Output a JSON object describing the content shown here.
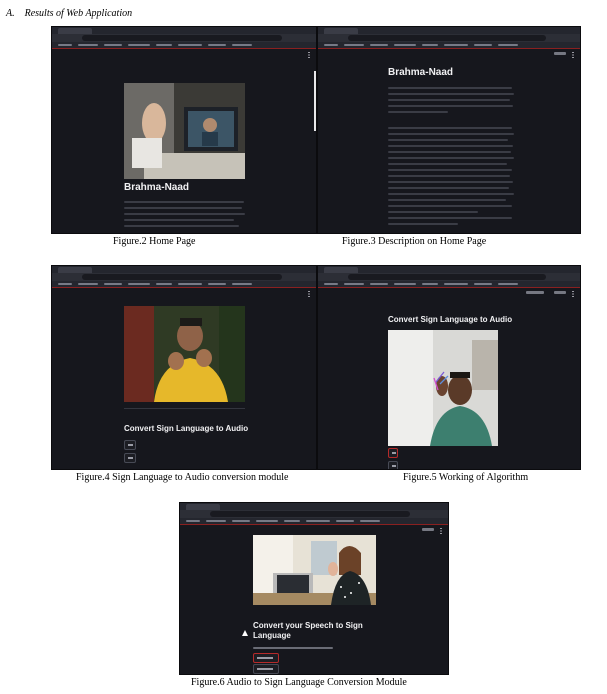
{
  "section": {
    "number": "A.",
    "title": "Results of Web Application"
  },
  "app": {
    "name": "Brahma-Naad",
    "sign_to_audio_title": "Convert Sign Language to Audio",
    "speech_to_sign_title": "Convert your Speech to Sign Language"
  },
  "figures": [
    {
      "caption": "Figure.2   Home Page"
    },
    {
      "caption": "Figure.3   Description on Home Page"
    },
    {
      "caption": "Figure.4  Sign Language to Audio conversion module"
    },
    {
      "caption": "Figure.5  Working of Algorithm"
    },
    {
      "caption": "Figure.6 Audio to Sign Language Conversion Module"
    }
  ],
  "colors": {
    "page_background": "#ffffff",
    "app_background": "#16171d",
    "browser_chrome": "#24262e",
    "accent_red": "#b52a2a"
  }
}
